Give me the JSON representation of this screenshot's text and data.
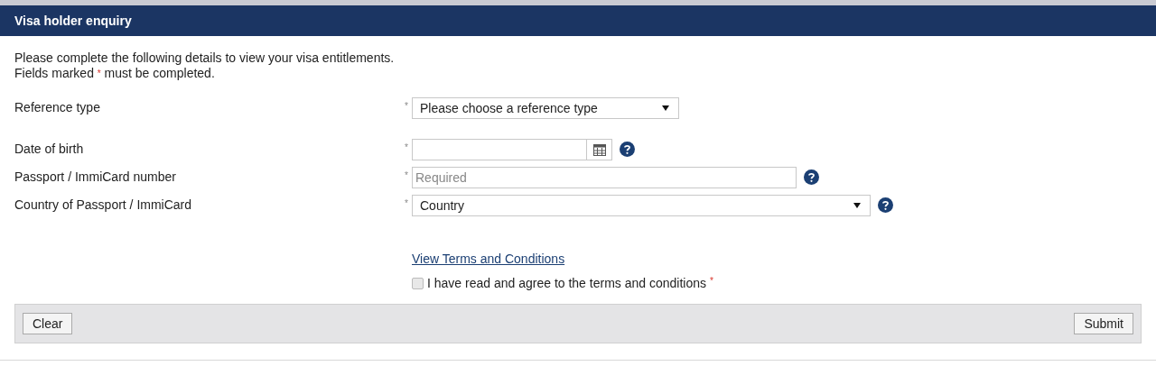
{
  "panel": {
    "title": "Visa holder enquiry"
  },
  "intro": "Please complete the following details to view your visa entitlements.",
  "required_note": {
    "before": "Fields marked",
    "marker": "*",
    "after": "must be completed."
  },
  "fields": [
    {
      "kind": "select",
      "label": "Reference type",
      "required": true,
      "value": "Please choose a reference type",
      "help": false
    },
    {
      "kind": "date",
      "label": "Date of birth",
      "required": true,
      "help": true
    },
    {
      "kind": "text",
      "label": "Passport / ImmiCard number",
      "required": true,
      "placeholder": "Required",
      "help": true
    },
    {
      "kind": "select",
      "label": "Country of Passport / ImmiCard",
      "required": true,
      "value": "Country",
      "help": true
    }
  ],
  "terms_link": "View Terms and Conditions",
  "agree": {
    "label": "I have read and agree to the terms and conditions",
    "checked": false,
    "required": true,
    "marker": "*"
  },
  "buttons": [
    {
      "label": "Clear"
    },
    {
      "label": "Submit"
    }
  ]
}
